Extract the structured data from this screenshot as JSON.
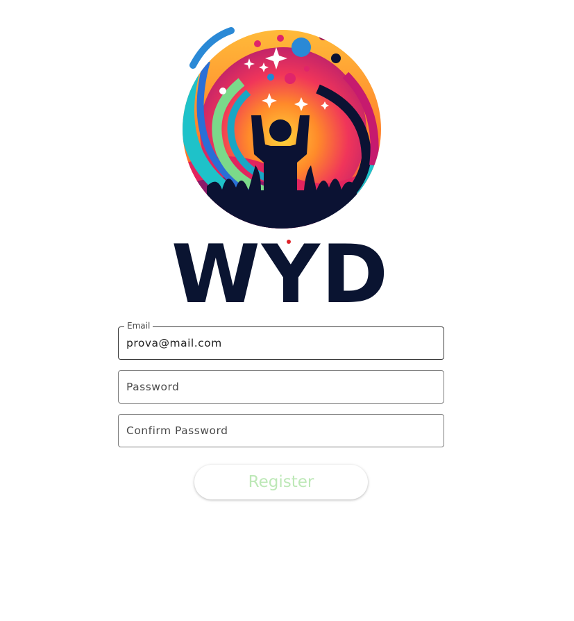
{
  "brand": {
    "name": "WYD"
  },
  "colors": {
    "brand_text": "#0a1431",
    "button_text": "#bde8b7",
    "field_border": "#7d7d7d"
  },
  "form": {
    "email": {
      "label": "Email",
      "value": "prova@mail.com"
    },
    "password": {
      "placeholder": "Password",
      "value": ""
    },
    "confirm_password": {
      "placeholder": "Confirm Password",
      "value": ""
    },
    "register_label": "Register"
  }
}
